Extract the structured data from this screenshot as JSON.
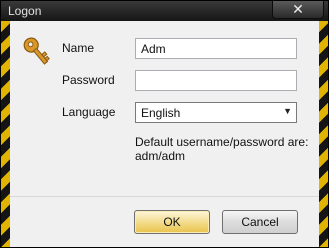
{
  "window": {
    "title": "Logon",
    "close_glyph": "✕"
  },
  "form": {
    "name_label": "Name",
    "name_value": "Adm",
    "password_label": "Password",
    "password_value": "",
    "language_label": "Language",
    "language_value": "English",
    "hint": "Default username/password are: adm/adm"
  },
  "buttons": {
    "ok": "OK",
    "cancel": "Cancel"
  },
  "icons": {
    "logo": "key-icon",
    "dropdown": "chevron-down-icon"
  },
  "colors": {
    "hazard_yellow": "#e0b400",
    "ok_button": "#f3dc8e"
  }
}
